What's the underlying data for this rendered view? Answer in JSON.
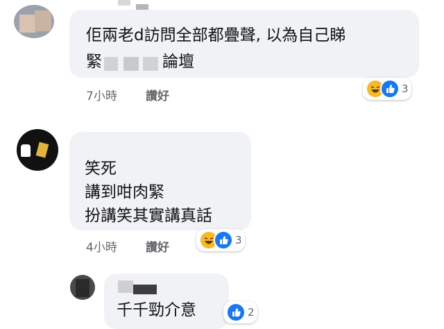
{
  "comments": [
    {
      "text_line1": "佢兩老d訪問全部都疊聲, 以為自己睇",
      "text_line2_pre": "緊",
      "text_line2_post": "論壇",
      "time": "7小時",
      "like_label": "讚好",
      "reaction_icons": [
        "haha-icon",
        "like-icon"
      ],
      "reaction_count": "3"
    },
    {
      "lines": [
        "笑死",
        "講到咁肉緊",
        "扮講笑其實講真話"
      ],
      "time": "4小時",
      "like_label": "讚好",
      "reaction_icons": [
        "haha-icon",
        "like-icon"
      ],
      "reaction_count": "3"
    },
    {
      "text": "千千勁介意",
      "reaction_icons": [
        "like-icon"
      ],
      "reaction_count": "2"
    }
  ],
  "colors": {
    "bubble": "#f0f2f5",
    "meta": "#65676b",
    "like_blue": "#1877f2",
    "haha_yellow": "#f7b928"
  }
}
